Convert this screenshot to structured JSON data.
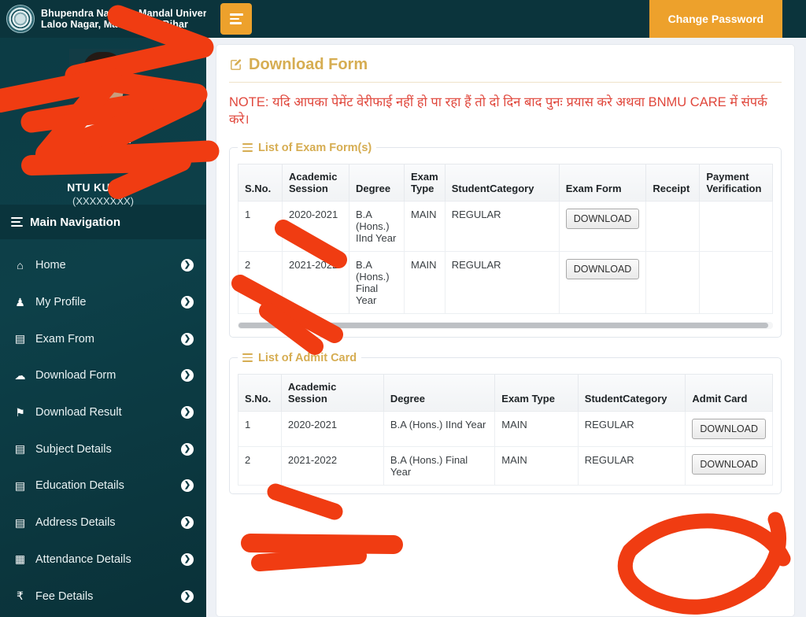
{
  "header": {
    "university_name_line1": "Bhupendra Narayan Mandal University",
    "university_name_line2": "Laloo Nagar, Madhepura, Bihar",
    "logo_icon": "university-seal-icon",
    "toggle_icon": "hamburger-menu-icon",
    "change_password_label": "Change Password",
    "accent_orange": "#eda12c",
    "bar_color": "#0b343c"
  },
  "sidebar": {
    "user_name": "NTU KUMARI",
    "user_id": "(XXXXXXXX)",
    "nav_title": "Main Navigation",
    "nav_title_icon": "hamburger-menu-icon",
    "background": "#0c3b44",
    "items": [
      {
        "label": "Home",
        "icon": "home-icon",
        "glyph": "⌂"
      },
      {
        "label": "My Profile",
        "icon": "user-icon",
        "glyph": "♟"
      },
      {
        "label": "Exam From",
        "icon": "book-icon",
        "glyph": "▤"
      },
      {
        "label": "Download Form",
        "icon": "cloud-download-icon",
        "glyph": "☁"
      },
      {
        "label": "Download Result",
        "icon": "graduation-cap-icon",
        "glyph": "⚑"
      },
      {
        "label": "Subject Details",
        "icon": "book-icon",
        "glyph": "▤"
      },
      {
        "label": "Education Details",
        "icon": "book-icon",
        "glyph": "▤"
      },
      {
        "label": "Address Details",
        "icon": "book-icon",
        "glyph": "▤"
      },
      {
        "label": "Attendance Details",
        "icon": "calendar-check-icon",
        "glyph": "▦"
      },
      {
        "label": "Fee Details",
        "icon": "rupee-icon",
        "glyph": "₹"
      }
    ],
    "chevron_icon": "chevron-right-icon",
    "chevron_glyph": "❯"
  },
  "main": {
    "page_title": "Download Form",
    "page_title_icon": "edit-square-icon",
    "title_color": "#d6ad52",
    "note_text": "NOTE: यदि आपका पेमेंट वेरीफाई नहीं हो पा रहा हैं तो दो दिन बाद पुनः प्रयास करे अथवा BNMU CARE में संपर्क करे।",
    "note_color": "#e0473c",
    "exam_form_section": {
      "legend": "List of Exam Form(s)",
      "legend_icon": "list-icon",
      "columns": [
        "S.No.",
        "Academic Session",
        "Degree",
        "Exam Type",
        "StudentCategory",
        "Exam Form",
        "Receipt",
        "Payment Verification"
      ],
      "rows": [
        {
          "sno": "1",
          "session": "2020-2021",
          "degree": "B.A (Hons.) IInd Year",
          "exam_type": "MAIN",
          "category": "REGULAR",
          "exam_form_button": "DOWNLOAD",
          "receipt": "",
          "payment_verification": ""
        },
        {
          "sno": "2",
          "session": "2021-2022",
          "degree": "B.A (Hons.) Final Year",
          "exam_type": "MAIN",
          "category": "REGULAR",
          "exam_form_button": "DOWNLOAD",
          "receipt": "",
          "payment_verification": ""
        }
      ]
    },
    "admit_card_section": {
      "legend": "List of Admit Card",
      "legend_icon": "list-icon",
      "columns": [
        "S.No.",
        "Academic Session",
        "Degree",
        "Exam Type",
        "StudentCategory",
        "Admit Card"
      ],
      "rows": [
        {
          "sno": "1",
          "session": "2020-2021",
          "degree": "B.A (Hons.) IInd Year",
          "exam_type": "MAIN",
          "category": "REGULAR",
          "admit_card_button": "DOWNLOAD"
        },
        {
          "sno": "2",
          "session": "2021-2022",
          "degree": "B.A (Hons.) Final Year",
          "exam_type": "MAIN",
          "category": "REGULAR",
          "admit_card_button": "DOWNLOAD"
        }
      ]
    }
  },
  "annotations": {
    "color": "#f03c12",
    "description": "hand-drawn red scribbles over profile photo, session column and circle around last DOWNLOAD button"
  }
}
